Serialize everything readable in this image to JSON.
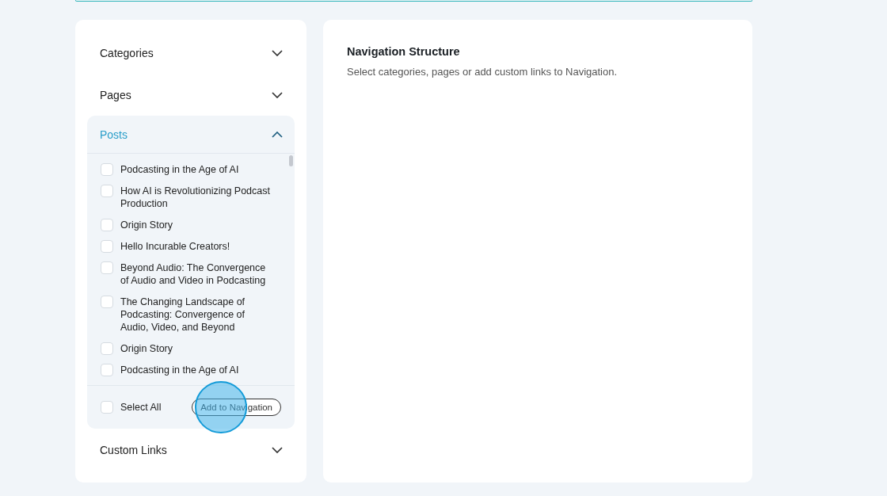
{
  "sections": [
    {
      "title": "Categories",
      "expanded": false
    },
    {
      "title": "Pages",
      "expanded": false
    },
    {
      "title": "Posts",
      "expanded": true,
      "items": [
        {
          "label": "Podcasting in the Age of AI",
          "checked": false
        },
        {
          "label": "How AI is Revolutionizing Podcast Production",
          "checked": false
        },
        {
          "label": "Origin Story",
          "checked": false
        },
        {
          "label": "Hello Incurable Creators!",
          "checked": false
        },
        {
          "label": "Beyond Audio: The Convergence of Audio and Video in Podcasting",
          "checked": false
        },
        {
          "label": "The Changing Landscape of Podcasting: Convergence of Audio, Video, and Beyond",
          "checked": false
        },
        {
          "label": "Origin Story",
          "checked": false
        },
        {
          "label": "Podcasting in the Age of AI",
          "checked": false
        }
      ],
      "select_all": {
        "label": "Select All",
        "checked": false
      },
      "button": "Add to Navigation"
    },
    {
      "title": "Custom Links",
      "expanded": false
    }
  ],
  "structure": {
    "title": "Navigation Structure",
    "description": "Select categories, pages or add custom links to Navigation."
  }
}
